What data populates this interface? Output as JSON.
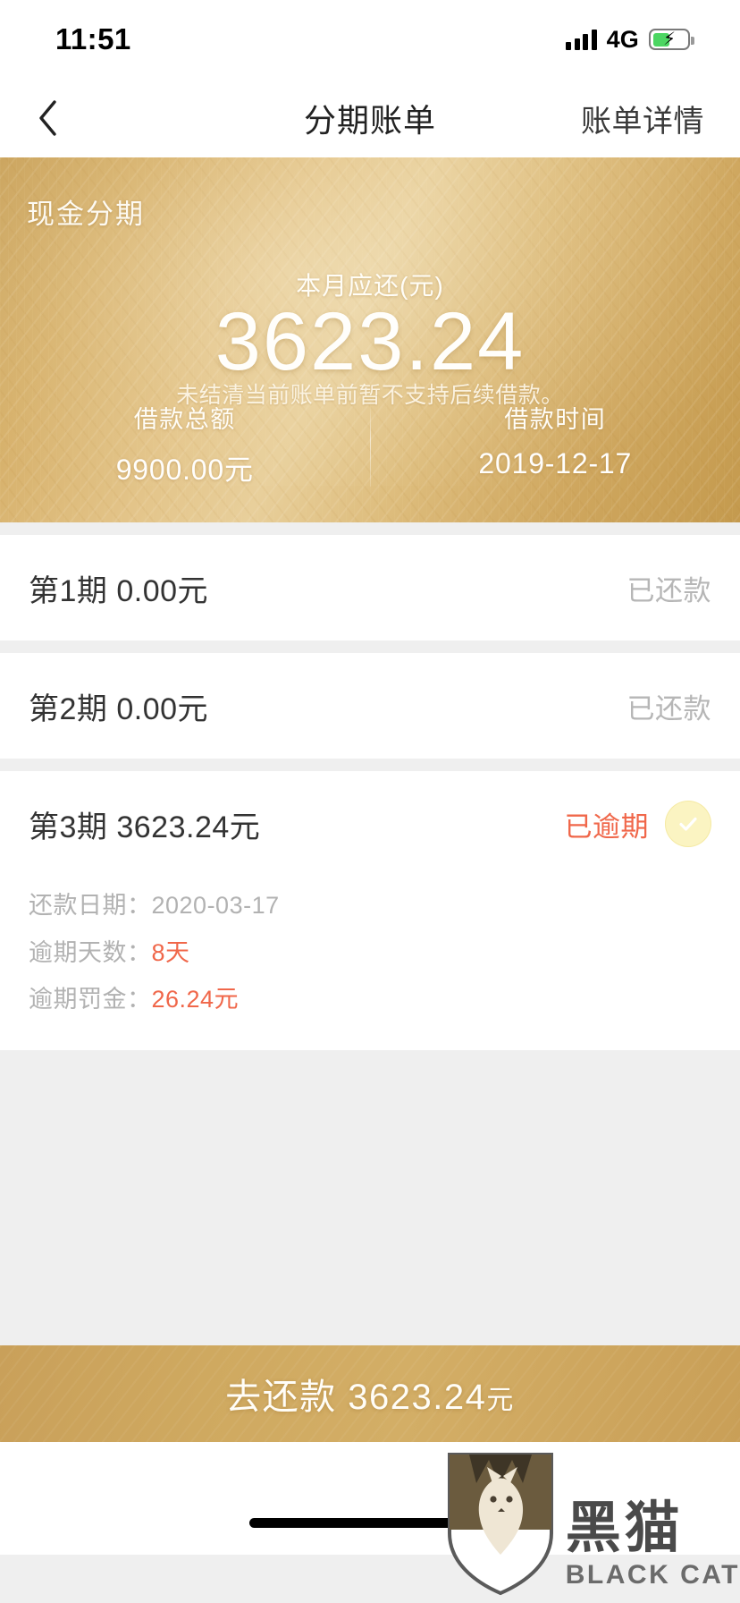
{
  "status_bar": {
    "time": "11:51",
    "network": "4G",
    "signal_icon": "signal-bars-icon",
    "battery_icon": "battery-charging-icon",
    "battery_level_percent": 50
  },
  "nav": {
    "back_icon": "chevron-left-icon",
    "title": "分期账单",
    "right_action": "账单详情"
  },
  "hero": {
    "tag": "现金分期",
    "sub_label": "本月应还(元)",
    "amount": "3623.24",
    "note": "未结清当前账单前暂不支持后续借款。",
    "stats": [
      {
        "label": "借款总额",
        "value": "9900.00元"
      },
      {
        "label": "借款时间",
        "value": "2019-12-17"
      }
    ]
  },
  "installments": [
    {
      "title": "第1期 0.00元",
      "status": "已还款",
      "status_type": "paid",
      "has_seal": false,
      "details": []
    },
    {
      "title": "第2期 0.00元",
      "status": "已还款",
      "status_type": "paid",
      "has_seal": false,
      "details": []
    },
    {
      "title": "第3期 3623.24元",
      "status": "已逾期",
      "status_type": "overdue",
      "has_seal": true,
      "seal_icon": "check-circle-icon",
      "details": [
        {
          "label": "还款日期：",
          "value": "2020-03-17",
          "alert": false
        },
        {
          "label": "逾期天数：",
          "value": "8天",
          "alert": true
        },
        {
          "label": "逾期罚金：",
          "value": "26.24元",
          "alert": true
        }
      ]
    }
  ],
  "cta": {
    "label": "去还款 3623.24",
    "unit": "元"
  },
  "watermark": {
    "cn": "黑猫",
    "en": "BLACK CAT",
    "shield_icon": "cat-shield-logo-icon"
  },
  "colors": {
    "gold": "#cfa760",
    "overdue": "#f0674a",
    "paid": "#b6b6b6",
    "page_bg": "#efefef"
  }
}
